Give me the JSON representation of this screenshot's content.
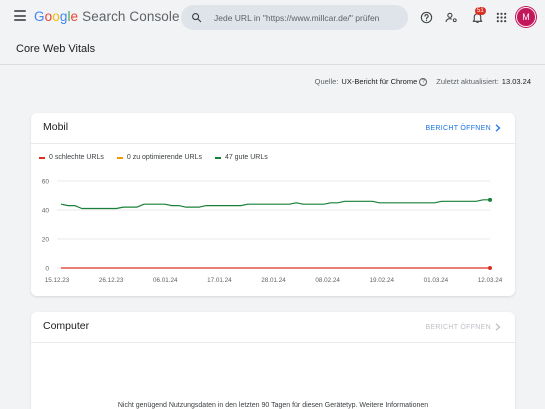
{
  "app": {
    "title_parts": [
      "G",
      "o",
      "o",
      "g",
      "l",
      "e"
    ],
    "title_suffix": "Search Console"
  },
  "search": {
    "placeholder": "Jede URL in \"https://www.millcar.de/\" prüfen"
  },
  "header": {
    "notification_count": "51",
    "avatar_letter": "M"
  },
  "page": {
    "title": "Core Web Vitals"
  },
  "source": {
    "label": "Quelle:",
    "value": "UX-Bericht für Chrome",
    "updated_label": "Zuletzt aktualisiert:",
    "updated_value": "13.03.24"
  },
  "mobile_card": {
    "title": "Mobil",
    "action": "BERICHT ÖFFNEN",
    "legend": [
      {
        "label": "0 schlechte URLs",
        "color": "#d93025"
      },
      {
        "label": "0 zu optimierende URLs",
        "color": "#f29900"
      },
      {
        "label": "47 gute URLs",
        "color": "#188038"
      }
    ]
  },
  "computer_card": {
    "title": "Computer",
    "action": "BERICHT ÖFFNEN",
    "message": "Nicht genügend Nutzungsdaten in den letzten 90 Tagen für diesen Gerätetyp. Weitere Informationen"
  },
  "colors": {
    "bad": "#d93025",
    "needs_improvement": "#f29900",
    "good": "#188038",
    "accent": "#1a73e8"
  },
  "chart_data": {
    "type": "line",
    "x_ticks": [
      "15.12.23",
      "26.12.23",
      "06.01.24",
      "17.01.24",
      "28.01.24",
      "08.02.24",
      "19.02.24",
      "01.03.24",
      "12.03.24"
    ],
    "y_ticks": [
      "60",
      "40",
      "20",
      "0"
    ],
    "ylim": [
      0,
      60
    ],
    "grid": true,
    "series": [
      {
        "name": "gute URLs",
        "color": "#188038",
        "values": [
          44,
          43,
          43,
          41,
          41,
          41,
          41,
          41,
          41,
          42,
          42,
          42,
          44,
          44,
          44,
          44,
          43,
          43,
          42,
          42,
          42,
          43,
          43,
          43,
          43,
          43,
          43,
          44,
          44,
          44,
          44,
          44,
          44,
          44,
          45,
          44,
          44,
          44,
          44,
          45,
          45,
          46,
          46,
          46,
          46,
          46,
          45,
          45,
          45,
          45,
          45,
          45,
          45,
          45,
          45,
          46,
          46,
          46,
          46,
          46,
          46,
          47,
          47
        ]
      },
      {
        "name": "schlechte URLs",
        "color": "#d93025",
        "values": [
          0,
          0,
          0,
          0,
          0,
          0,
          0,
          0,
          0,
          0,
          0,
          0,
          0,
          0,
          0,
          0,
          0,
          0,
          0,
          0,
          0,
          0,
          0,
          0,
          0,
          0,
          0,
          0,
          0,
          0,
          0,
          0,
          0,
          0,
          0,
          0,
          0,
          0,
          0,
          0,
          0,
          0,
          0,
          0,
          0,
          0,
          0,
          0,
          0,
          0,
          0,
          0,
          0,
          0,
          0,
          0,
          0,
          0,
          0,
          0,
          0,
          0,
          0
        ]
      }
    ]
  }
}
